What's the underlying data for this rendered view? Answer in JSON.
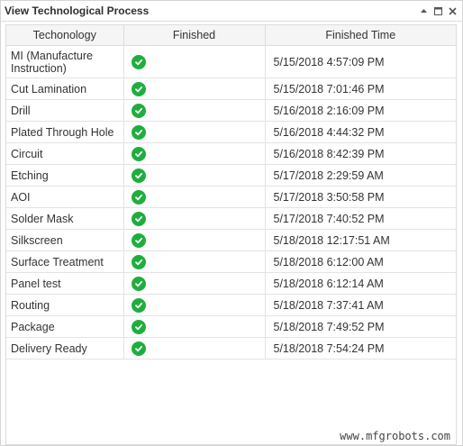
{
  "window": {
    "title": "View Technological Process",
    "controls": [
      "pin-icon",
      "maximize-icon",
      "close-icon"
    ]
  },
  "table": {
    "columns": [
      "Techonology",
      "Finished",
      "Finished Time"
    ],
    "rows": [
      {
        "technology": "MI (Manufacture Instruction)",
        "finished": "check-icon",
        "time": "5/15/2018 4:57:09 PM"
      },
      {
        "technology": "Cut Lamination",
        "finished": "check-icon",
        "time": "5/15/2018 7:01:46 PM"
      },
      {
        "technology": "Drill",
        "finished": "check-icon",
        "time": "5/16/2018 2:16:09 PM"
      },
      {
        "technology": "Plated Through Hole",
        "finished": "check-icon",
        "time": "5/16/2018 4:44:32 PM"
      },
      {
        "technology": "Circuit",
        "finished": "check-icon",
        "time": "5/16/2018 8:42:39 PM"
      },
      {
        "technology": "Etching",
        "finished": "check-icon",
        "time": "5/17/2018 2:29:59 AM"
      },
      {
        "technology": "AOI",
        "finished": "check-icon",
        "time": "5/17/2018 3:50:58 PM"
      },
      {
        "technology": "Solder Mask",
        "finished": "check-icon",
        "time": "5/17/2018 7:40:52 PM"
      },
      {
        "technology": "Silkscreen",
        "finished": "check-icon",
        "time": "5/18/2018 12:17:51 AM"
      },
      {
        "technology": "Surface Treatment",
        "finished": "check-icon",
        "time": "5/18/2018 6:12:00 AM"
      },
      {
        "technology": "Panel test",
        "finished": "check-icon",
        "time": "5/18/2018 6:12:14 AM"
      },
      {
        "technology": "Routing",
        "finished": "check-icon",
        "time": "5/18/2018 7:37:41 AM"
      },
      {
        "technology": "Package",
        "finished": "check-icon",
        "time": "5/18/2018 7:49:52 PM"
      },
      {
        "technology": "Delivery Ready",
        "finished": "check-icon",
        "time": "5/18/2018 7:54:24 PM"
      }
    ]
  },
  "colors": {
    "check": "#1fae3e",
    "header_bg": "#f5f5f5",
    "border": "#dcdcdc"
  },
  "watermark": "www.mfgrobots.com"
}
